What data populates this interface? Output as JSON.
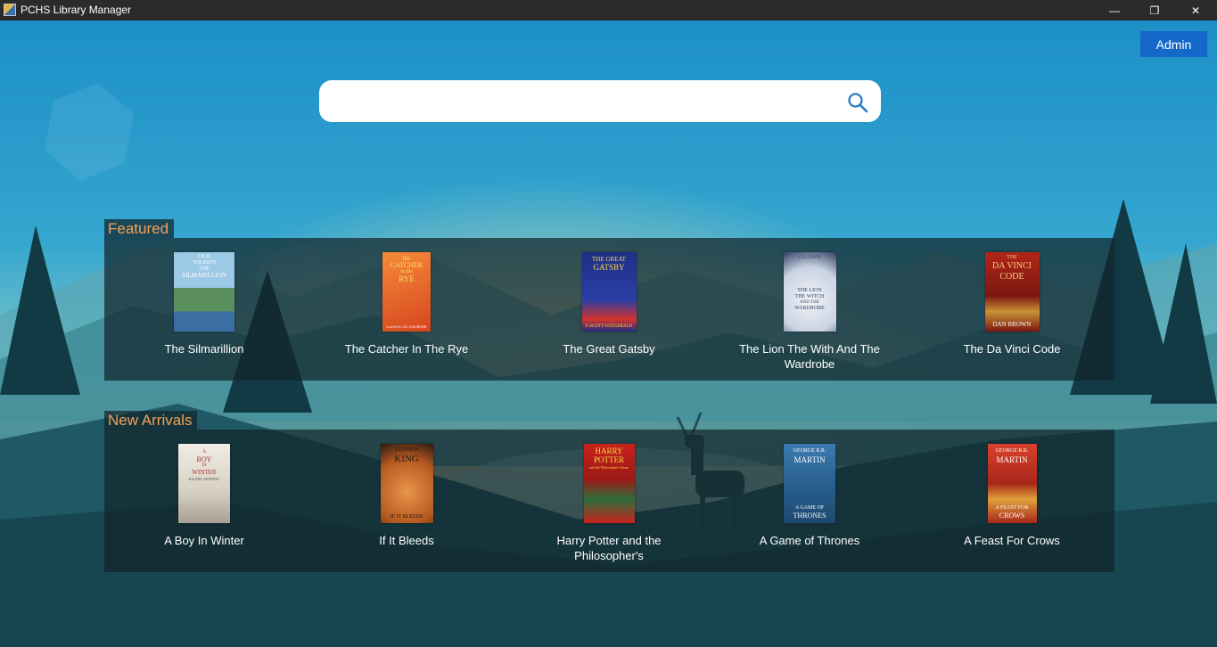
{
  "window": {
    "title": "PCHS Library Manager",
    "minimize_glyph": "—",
    "restore_glyph": "❐",
    "close_glyph": "✕"
  },
  "header": {
    "admin_label": "Admin"
  },
  "search": {
    "value": "",
    "placeholder": ""
  },
  "sections": {
    "featured": {
      "label": "Featured",
      "books": [
        {
          "title": "The Silmarillion",
          "cover_text": [
            "J.R.R.",
            "TOLKIEN",
            "THE",
            "SILMARILLION"
          ]
        },
        {
          "title": "The Catcher In The Rye",
          "cover_text": [
            "the",
            "CATCHER",
            "in the",
            "RYE",
            "a novel by J.D. SALINGER"
          ]
        },
        {
          "title": "The Great Gatsby",
          "cover_text": [
            "THE GREAT",
            "GATSBY",
            "F·SCOTT FITZGERALD"
          ]
        },
        {
          "title": "The Lion The With And The Wardrobe",
          "cover_text": [
            "C.S. LEWIS",
            "THE LION",
            "THE WITCH",
            "AND THE",
            "WARDROBE"
          ]
        },
        {
          "title": "The Da Vinci Code",
          "cover_text": [
            "THE",
            "DA VINCI",
            "CODE",
            "DAN BROWN"
          ]
        }
      ]
    },
    "new_arrivals": {
      "label": "New Arrivals",
      "books": [
        {
          "title": "A Boy In Winter",
          "cover_text": [
            "A",
            "BOY",
            "IN",
            "WINTER",
            "RACHEL SEIFFERT"
          ]
        },
        {
          "title": "If It Bleeds",
          "cover_text": [
            "STEPHEN",
            "KING",
            "IF IT BLEEDS"
          ]
        },
        {
          "title": "Harry Potter and the Philosopher's",
          "cover_text": [
            "HARRY",
            "POTTER",
            "and the Philosopher's Stone"
          ]
        },
        {
          "title": "A Game of Thrones",
          "cover_text": [
            "GEORGE R.R.",
            "MARTIN",
            "A GAME OF",
            "THRONES"
          ]
        },
        {
          "title": "A Feast For Crows",
          "cover_text": [
            "GEORGE R.R.",
            "MARTIN",
            "A FEAST FOR",
            "CROWS"
          ]
        }
      ]
    }
  }
}
